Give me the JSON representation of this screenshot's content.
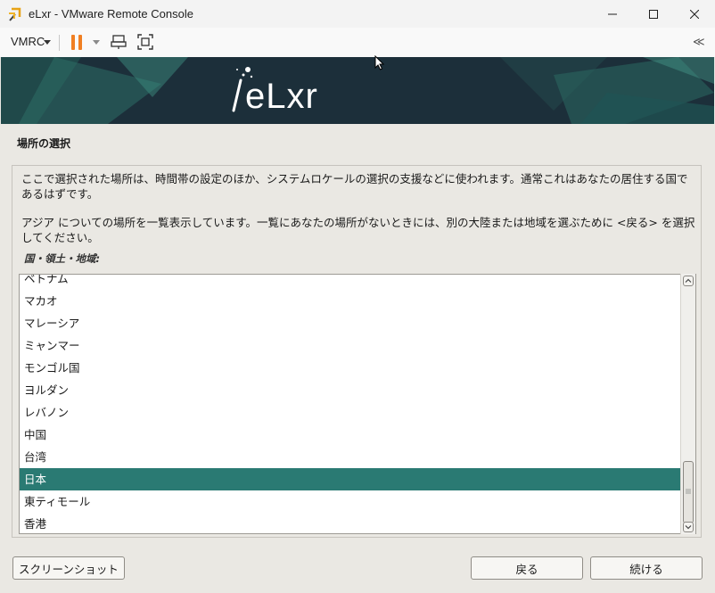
{
  "window": {
    "title": "eLxr - VMware Remote Console",
    "minimize_glyph": "—",
    "maximize_glyph": "☐",
    "close_glyph": "✕"
  },
  "toolbar": {
    "vmrc_label": "VMRC",
    "collapse_label": "≪",
    "icons": [
      "pause-icon",
      "send-ctrl-alt-del-icon",
      "fullscreen-icon"
    ],
    "pause_color": "#f07f22"
  },
  "banner": {
    "logo_text": "eLxr"
  },
  "installer": {
    "section_title": "場所の選択",
    "para1": "ここで選択された場所は、時間帯の設定のほか、システムロケールの選択の支援などに使われます。通常これはあなたの居住する国であるはずです。",
    "para2": "アジア についての場所を一覧表示しています。一覧にあなたの場所がないときには、別の大陸または地域を選ぶために <戻る> を選択してください。",
    "field_label": "国・領土・地域:",
    "list_items": [
      "ベトナム",
      "マカオ",
      "マレーシア",
      "ミャンマー",
      "モンゴル国",
      "ヨルダン",
      "レバノン",
      "中国",
      "台湾",
      "日本",
      "東ティモール",
      "香港"
    ],
    "selected_item": "日本",
    "selected_color": "#2a7a73",
    "buttons": {
      "screenshot": "スクリーンショット",
      "back": "戻る",
      "continue": "続ける"
    }
  }
}
